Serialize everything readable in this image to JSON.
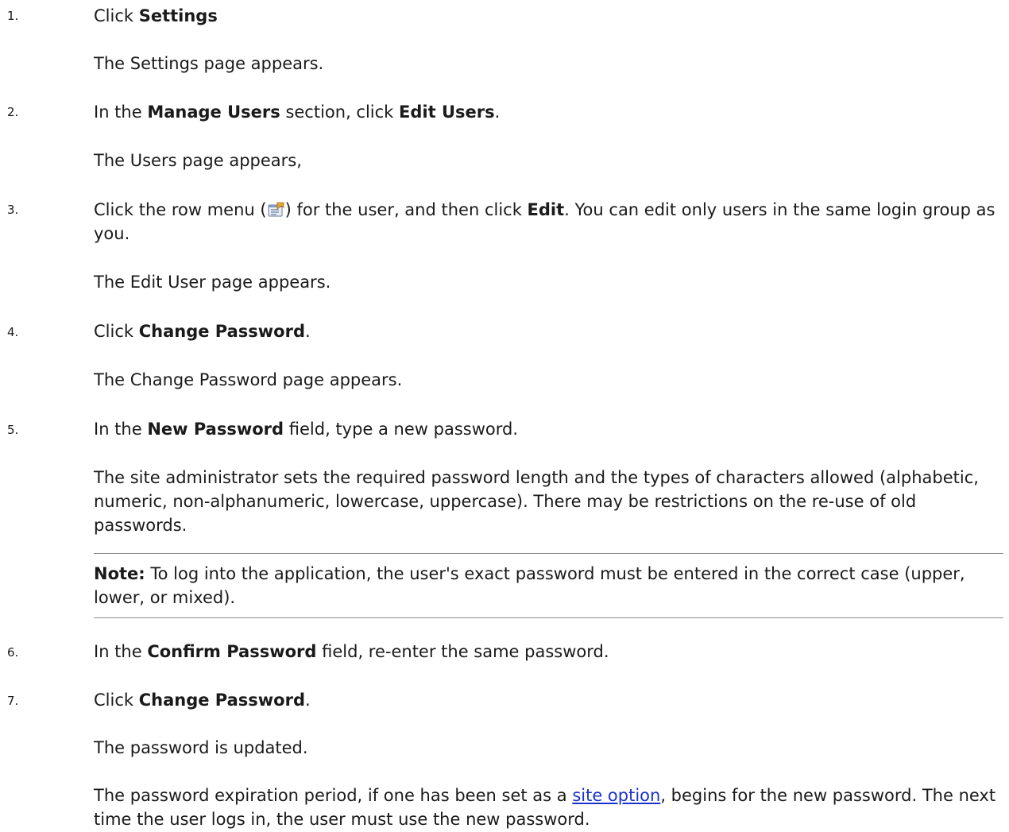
{
  "steps": [
    {
      "num": "1.",
      "instruction": {
        "pre": "Click ",
        "bold": "Settings",
        "post": ""
      },
      "result": "The Settings page appears."
    },
    {
      "num": "2.",
      "instruction": {
        "pre": "In the ",
        "bold1": "Manage Users",
        "mid": " section, click ",
        "bold2": "Edit Users",
        "post": "."
      },
      "result": "The Users page appears,"
    },
    {
      "num": "3.",
      "instruction": {
        "pre": "Click the row menu (",
        "icon": "row-menu-icon",
        "mid": ") for the user, and then click ",
        "bold": "Edit",
        "post": ". You can edit only users in the same login group as you."
      },
      "result": "The Edit User page appears."
    },
    {
      "num": "4.",
      "instruction": {
        "pre": "Click ",
        "bold": "Change Password",
        "post": "."
      },
      "result": "The Change Password page appears."
    },
    {
      "num": "5.",
      "instruction": {
        "pre": "In the ",
        "bold": "New Password",
        "post": " field, type a new password."
      },
      "result": "The site administrator sets the required password length and the types of characters allowed (alphabetic, numeric, non-alphanumeric, lowercase, uppercase). There may be restrictions on the re-use of old passwords.",
      "note": {
        "label": "Note:",
        "text": " To log into the application, the user's exact password must be entered in the correct case (upper, lower, or mixed)."
      }
    },
    {
      "num": "6.",
      "instruction": {
        "pre": "In the ",
        "bold": "Confirm Password",
        "post": " field, re-enter the same password."
      }
    },
    {
      "num": "7.",
      "instruction": {
        "pre": "Click ",
        "bold": "Change Password",
        "post": "."
      },
      "result": "The password is updated.",
      "extra": {
        "pre": "The password expiration period, if one has been set as a ",
        "link": "site option",
        "post": ", begins for the new password. The next time the user logs in, the user must use the new password."
      }
    }
  ]
}
